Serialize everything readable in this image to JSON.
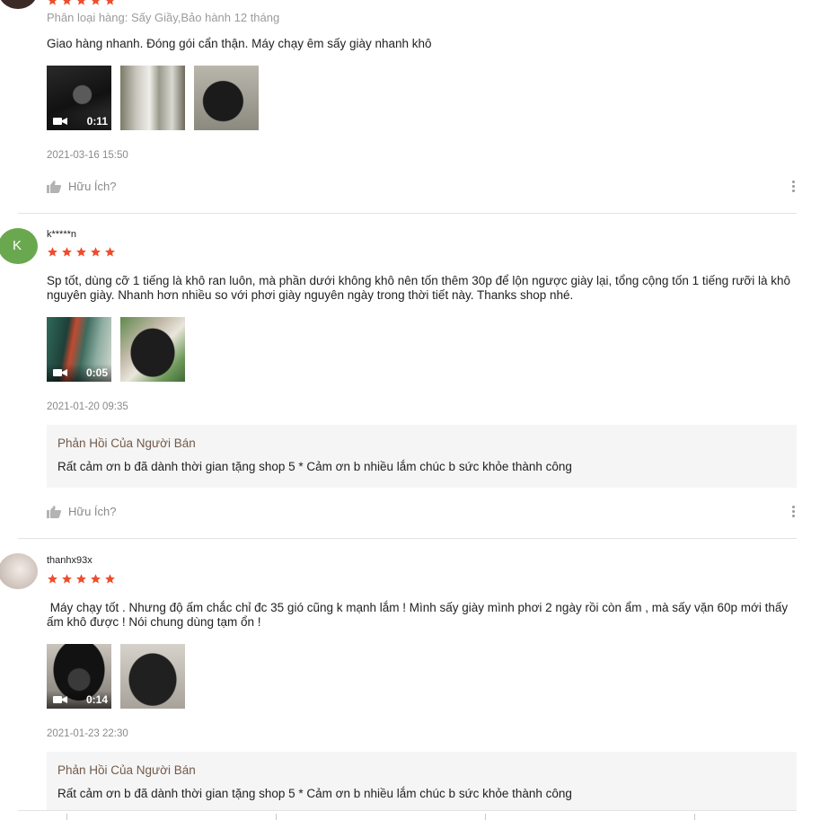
{
  "colors": {
    "star": "#ee4d2d",
    "reply_title": "#725a4a",
    "reply_bg": "#f5f5f5",
    "avatar_green": "#6aa84f"
  },
  "reviews": [
    {
      "username": "",
      "rating": 5,
      "variant": "Phân loại hàng: Sấy Giầy,Bảo hành 12 tháng",
      "comment": "Giao hàng nhanh. Đóng gói cẩn thận. Máy chạy êm sấy giày nhanh khô",
      "media": [
        {
          "type": "video",
          "duration": "0:11"
        },
        {
          "type": "image"
        },
        {
          "type": "image"
        }
      ],
      "date": "2021-03-16 15:50",
      "helpful_label": "Hữu Ích?"
    },
    {
      "username": "k*****n",
      "avatar_letter": "K",
      "rating": 5,
      "comment": "Sp tốt, dùng cỡ 1 tiếng là khô ran luôn, mà phần dưới không khô nên tốn thêm 30p để lộn ngược giày lại, tổng cộng tốn 1 tiếng rưỡi là khô nguyên giày. Nhanh hơn nhiều so với phơi giày nguyên ngày trong thời tiết này. Thanks shop nhé.",
      "media": [
        {
          "type": "video",
          "duration": "0:05"
        },
        {
          "type": "image"
        }
      ],
      "date": "2021-01-20 09:35",
      "seller_reply": {
        "title": "Phản Hồi Của Người Bán",
        "text": "Rất cảm ơn b đã dành thời gian tặng shop 5 * Cảm ơn b nhiều lắm chúc b sức khỏe thành công"
      },
      "helpful_label": "Hữu Ích?"
    },
    {
      "username": "thanhx93x",
      "rating": 5,
      "comment": " Máy chạy tốt . Nhưng độ ấm chắc chỉ đc 35 gió cũng k mạnh lắm ! Mình sấy giày mình phơi 2 ngày rồi còn ẩm , mà sấy vặn 60p mới thấy ấm khô được ! Nói chung dùng tạm ổn !",
      "media": [
        {
          "type": "video",
          "duration": "0:14"
        },
        {
          "type": "image"
        }
      ],
      "date": "2021-01-23 22:30",
      "seller_reply": {
        "title": "Phản Hồi Của Người Bán",
        "text": "Rất cảm ơn b đã dành thời gian tặng shop 5 * Cảm ơn b nhiều lắm chúc b sức khỏe thành công"
      }
    }
  ]
}
